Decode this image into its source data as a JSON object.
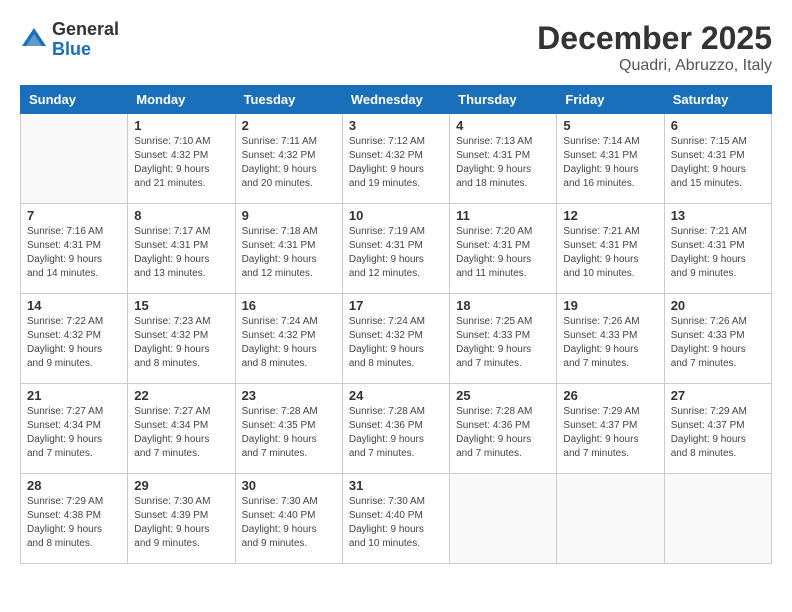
{
  "logo": {
    "general": "General",
    "blue": "Blue"
  },
  "title": {
    "month_year": "December 2025",
    "location": "Quadri, Abruzzo, Italy"
  },
  "days_of_week": [
    "Sunday",
    "Monday",
    "Tuesday",
    "Wednesday",
    "Thursday",
    "Friday",
    "Saturday"
  ],
  "weeks": [
    [
      {
        "day": "",
        "info": ""
      },
      {
        "day": "1",
        "info": "Sunrise: 7:10 AM\nSunset: 4:32 PM\nDaylight: 9 hours\nand 21 minutes."
      },
      {
        "day": "2",
        "info": "Sunrise: 7:11 AM\nSunset: 4:32 PM\nDaylight: 9 hours\nand 20 minutes."
      },
      {
        "day": "3",
        "info": "Sunrise: 7:12 AM\nSunset: 4:32 PM\nDaylight: 9 hours\nand 19 minutes."
      },
      {
        "day": "4",
        "info": "Sunrise: 7:13 AM\nSunset: 4:31 PM\nDaylight: 9 hours\nand 18 minutes."
      },
      {
        "day": "5",
        "info": "Sunrise: 7:14 AM\nSunset: 4:31 PM\nDaylight: 9 hours\nand 16 minutes."
      },
      {
        "day": "6",
        "info": "Sunrise: 7:15 AM\nSunset: 4:31 PM\nDaylight: 9 hours\nand 15 minutes."
      }
    ],
    [
      {
        "day": "7",
        "info": "Sunrise: 7:16 AM\nSunset: 4:31 PM\nDaylight: 9 hours\nand 14 minutes."
      },
      {
        "day": "8",
        "info": "Sunrise: 7:17 AM\nSunset: 4:31 PM\nDaylight: 9 hours\nand 13 minutes."
      },
      {
        "day": "9",
        "info": "Sunrise: 7:18 AM\nSunset: 4:31 PM\nDaylight: 9 hours\nand 12 minutes."
      },
      {
        "day": "10",
        "info": "Sunrise: 7:19 AM\nSunset: 4:31 PM\nDaylight: 9 hours\nand 12 minutes."
      },
      {
        "day": "11",
        "info": "Sunrise: 7:20 AM\nSunset: 4:31 PM\nDaylight: 9 hours\nand 11 minutes."
      },
      {
        "day": "12",
        "info": "Sunrise: 7:21 AM\nSunset: 4:31 PM\nDaylight: 9 hours\nand 10 minutes."
      },
      {
        "day": "13",
        "info": "Sunrise: 7:21 AM\nSunset: 4:31 PM\nDaylight: 9 hours\nand 9 minutes."
      }
    ],
    [
      {
        "day": "14",
        "info": "Sunrise: 7:22 AM\nSunset: 4:32 PM\nDaylight: 9 hours\nand 9 minutes."
      },
      {
        "day": "15",
        "info": "Sunrise: 7:23 AM\nSunset: 4:32 PM\nDaylight: 9 hours\nand 8 minutes."
      },
      {
        "day": "16",
        "info": "Sunrise: 7:24 AM\nSunset: 4:32 PM\nDaylight: 9 hours\nand 8 minutes."
      },
      {
        "day": "17",
        "info": "Sunrise: 7:24 AM\nSunset: 4:32 PM\nDaylight: 9 hours\nand 8 minutes."
      },
      {
        "day": "18",
        "info": "Sunrise: 7:25 AM\nSunset: 4:33 PM\nDaylight: 9 hours\nand 7 minutes."
      },
      {
        "day": "19",
        "info": "Sunrise: 7:26 AM\nSunset: 4:33 PM\nDaylight: 9 hours\nand 7 minutes."
      },
      {
        "day": "20",
        "info": "Sunrise: 7:26 AM\nSunset: 4:33 PM\nDaylight: 9 hours\nand 7 minutes."
      }
    ],
    [
      {
        "day": "21",
        "info": "Sunrise: 7:27 AM\nSunset: 4:34 PM\nDaylight: 9 hours\nand 7 minutes."
      },
      {
        "day": "22",
        "info": "Sunrise: 7:27 AM\nSunset: 4:34 PM\nDaylight: 9 hours\nand 7 minutes."
      },
      {
        "day": "23",
        "info": "Sunrise: 7:28 AM\nSunset: 4:35 PM\nDaylight: 9 hours\nand 7 minutes."
      },
      {
        "day": "24",
        "info": "Sunrise: 7:28 AM\nSunset: 4:36 PM\nDaylight: 9 hours\nand 7 minutes."
      },
      {
        "day": "25",
        "info": "Sunrise: 7:28 AM\nSunset: 4:36 PM\nDaylight: 9 hours\nand 7 minutes."
      },
      {
        "day": "26",
        "info": "Sunrise: 7:29 AM\nSunset: 4:37 PM\nDaylight: 9 hours\nand 7 minutes."
      },
      {
        "day": "27",
        "info": "Sunrise: 7:29 AM\nSunset: 4:37 PM\nDaylight: 9 hours\nand 8 minutes."
      }
    ],
    [
      {
        "day": "28",
        "info": "Sunrise: 7:29 AM\nSunset: 4:38 PM\nDaylight: 9 hours\nand 8 minutes."
      },
      {
        "day": "29",
        "info": "Sunrise: 7:30 AM\nSunset: 4:39 PM\nDaylight: 9 hours\nand 9 minutes."
      },
      {
        "day": "30",
        "info": "Sunrise: 7:30 AM\nSunset: 4:40 PM\nDaylight: 9 hours\nand 9 minutes."
      },
      {
        "day": "31",
        "info": "Sunrise: 7:30 AM\nSunset: 4:40 PM\nDaylight: 9 hours\nand 10 minutes."
      },
      {
        "day": "",
        "info": ""
      },
      {
        "day": "",
        "info": ""
      },
      {
        "day": "",
        "info": ""
      }
    ]
  ]
}
